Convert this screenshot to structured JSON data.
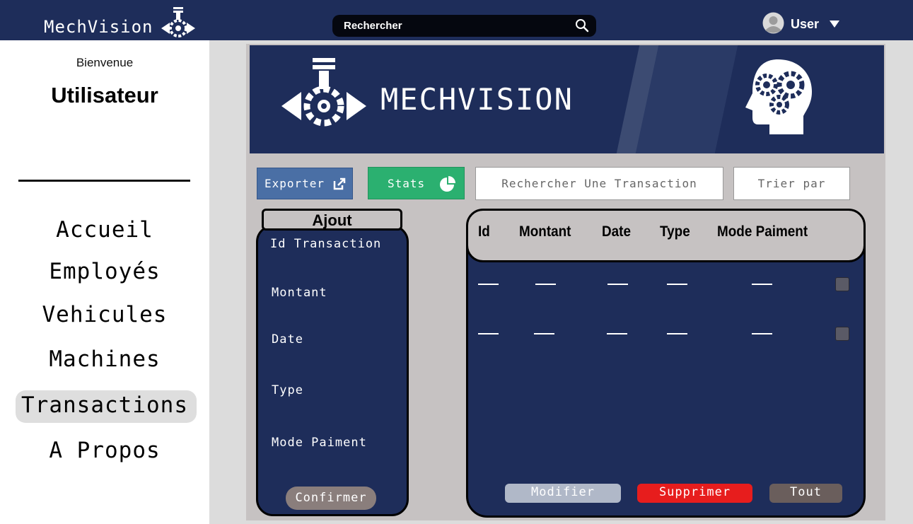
{
  "topbar": {
    "brand": "MechVision",
    "search_label": "Rechercher",
    "user_label": "User"
  },
  "sidebar": {
    "welcome": "Bienvenue",
    "username": "Utilisateur",
    "items": [
      {
        "label": "Accueil",
        "active": false
      },
      {
        "label": "Employés",
        "active": false
      },
      {
        "label": "Vehicules",
        "active": false
      },
      {
        "label": "Machines",
        "active": false
      },
      {
        "label": "Transactions",
        "active": true
      },
      {
        "label": "A Propos",
        "active": false
      }
    ]
  },
  "banner": {
    "title": "MECHVISION"
  },
  "toolbar": {
    "export_label": "Exporter",
    "stats_label": "Stats",
    "search_placeholder": "Rechercher Une Transaction",
    "sort_label": "Trier par"
  },
  "form": {
    "title": "Ajout",
    "fields": [
      "Id Transaction",
      "Montant",
      "Date",
      "Type",
      "Mode Paiment"
    ],
    "confirm_label": "Confirmer"
  },
  "table": {
    "columns": [
      "Id",
      "Montant",
      "Date",
      "Type",
      "Mode Paiment"
    ],
    "rows": [
      [
        "—",
        "—",
        "—",
        "—",
        "—"
      ],
      [
        "—",
        "—",
        "—",
        "—",
        "—"
      ]
    ],
    "modify_label": "Modifier",
    "delete_label": "Supprimer",
    "all_label": "Tout"
  },
  "colors": {
    "navy": "#1e2d5a",
    "export": "#4a6fa5",
    "stats": "#2bb070",
    "delete": "#e71d1d"
  }
}
